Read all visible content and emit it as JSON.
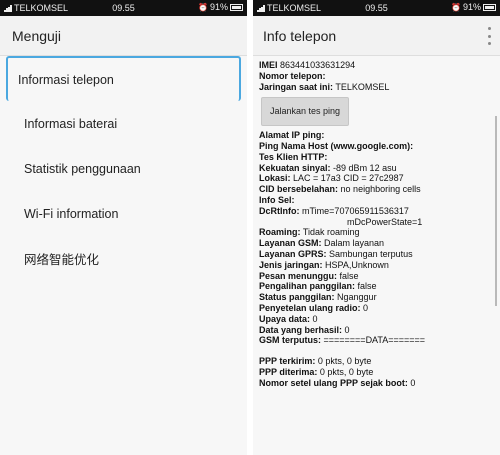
{
  "left": {
    "status": {
      "carrier": "TELKOMSEL",
      "time": "09.55",
      "battery": "91%"
    },
    "title": "Menguji",
    "items": [
      {
        "label": "Informasi telepon"
      },
      {
        "label": "Informasi baterai"
      },
      {
        "label": "Statistik penggunaan"
      },
      {
        "label": "Wi-Fi information"
      },
      {
        "label": "网络智能优化"
      }
    ]
  },
  "right": {
    "status": {
      "carrier": "TELKOMSEL",
      "time": "09.55",
      "battery": "91%"
    },
    "title": "Info telepon",
    "imei": {
      "label": "IMEI",
      "value": "863441033631294"
    },
    "phone_number": {
      "label": "Nomor telepon:",
      "value": ""
    },
    "network": {
      "label": "Jaringan saat ini:",
      "value": "TELKOMSEL"
    },
    "test_button": "Jalankan tes ping",
    "rows": [
      {
        "label": "Alamat IP ping:",
        "value": ""
      },
      {
        "label": "Ping Nama Host (www.google.com):",
        "value": ""
      },
      {
        "label": "Tes Klien HTTP:",
        "value": ""
      },
      {
        "label": "Kekuatan sinyal:",
        "value": "-89 dBm   12 asu"
      },
      {
        "label": "Lokasi:",
        "value": "LAC = 17a3   CID = 27c2987"
      },
      {
        "label": "CID bersebelahan:",
        "value": "no neighboring cells"
      },
      {
        "label": "Info Sel:",
        "value": ""
      },
      {
        "label": "DcRtInfo:",
        "value": "mTime=707065911536317"
      }
    ],
    "dcrt_cont": "mDcPowerState=1",
    "rows2": [
      {
        "label": "Roaming:",
        "value": "Tidak roaming"
      },
      {
        "label": "Layanan GSM:",
        "value": "Dalam layanan"
      },
      {
        "label": "Layanan GPRS:",
        "value": "Sambungan terputus"
      },
      {
        "label": "Jenis jaringan:",
        "value": "HSPA,Unknown"
      },
      {
        "label": "Pesan menunggu:",
        "value": "false"
      },
      {
        "label": "Pengalihan panggilan:",
        "value": "false"
      },
      {
        "label": "Status panggilan:",
        "value": "Nganggur"
      },
      {
        "label": "Penyetelan ulang radio:",
        "value": "0"
      },
      {
        "label": "Upaya data:",
        "value": "0"
      },
      {
        "label": "Data yang berhasil:",
        "value": "0"
      },
      {
        "label": "GSM terputus:",
        "value": "========DATA======="
      }
    ],
    "rows3": [
      {
        "label": "PPP terkirim:",
        "value": "0 pkts, 0 byte"
      },
      {
        "label": "PPP diterima:",
        "value": "0 pkts, 0 byte"
      },
      {
        "label": "Nomor setel ulang PPP sejak boot:",
        "value": "0"
      }
    ]
  }
}
